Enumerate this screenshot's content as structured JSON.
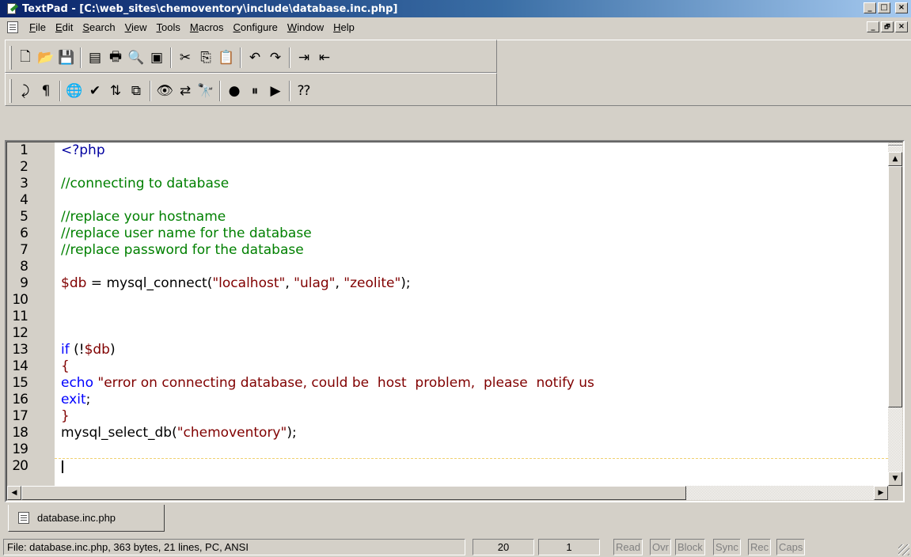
{
  "window": {
    "title": "TextPad - [C:\\web_sites\\chemoventory\\include\\database.inc.php]",
    "buttons": [
      "_",
      "□",
      "×"
    ]
  },
  "menu": {
    "items": [
      "File",
      "Edit",
      "Search",
      "View",
      "Tools",
      "Macros",
      "Configure",
      "Window",
      "Help"
    ],
    "underline": [
      "F",
      "E",
      "S",
      "V",
      "T",
      "M",
      "C",
      "W",
      "H"
    ],
    "mdi_buttons": [
      "_",
      "🗗",
      "×"
    ]
  },
  "toolbar1": {
    "buttons": [
      {
        "name": "new-file-icon",
        "glyph": "🗋"
      },
      {
        "name": "open-folder-icon",
        "glyph": "📂"
      },
      {
        "name": "save-icon",
        "glyph": "💾"
      },
      {
        "sep": true
      },
      {
        "name": "manage-files-icon",
        "glyph": "▤"
      },
      {
        "name": "print-icon",
        "glyph": "🖶"
      },
      {
        "name": "print-preview-icon",
        "glyph": "🔍"
      },
      {
        "name": "document-properties-icon",
        "glyph": "▣"
      },
      {
        "sep": true
      },
      {
        "name": "cut-icon",
        "glyph": "✂"
      },
      {
        "name": "copy-icon",
        "glyph": "⎘"
      },
      {
        "name": "paste-icon",
        "glyph": "📋"
      },
      {
        "sep": true
      },
      {
        "name": "undo-icon",
        "glyph": "↶"
      },
      {
        "name": "redo-icon",
        "glyph": "↷"
      },
      {
        "sep": true
      },
      {
        "name": "indent-icon",
        "glyph": "⇥"
      },
      {
        "name": "outdent-icon",
        "glyph": "⇤"
      }
    ]
  },
  "toolbar2": {
    "buttons": [
      {
        "name": "word-wrap-icon",
        "glyph": "⤸"
      },
      {
        "name": "visible-spaces-icon",
        "glyph": "¶"
      },
      {
        "sep": true
      },
      {
        "name": "web-browser-icon",
        "glyph": "🌐"
      },
      {
        "name": "spelling-icon",
        "glyph": "✔"
      },
      {
        "name": "sort-icon",
        "glyph": "⇅"
      },
      {
        "name": "compare-files-icon",
        "glyph": "⧉"
      },
      {
        "sep": true
      },
      {
        "name": "find-icon",
        "glyph": "👁"
      },
      {
        "name": "replace-icon",
        "glyph": "⇄"
      },
      {
        "name": "find-in-files-icon",
        "glyph": "🔭"
      },
      {
        "sep": true
      },
      {
        "name": "record-macro-icon",
        "glyph": "●"
      },
      {
        "name": "pause-macro-icon",
        "glyph": "⏸"
      },
      {
        "name": "play-macro-icon",
        "glyph": "▶"
      },
      {
        "sep": true
      },
      {
        "name": "context-help-icon",
        "glyph": "⁇"
      }
    ]
  },
  "editor": {
    "lines": [
      {
        "n": "1",
        "parts": [
          {
            "t": "<?php",
            "c": "c-tag"
          }
        ]
      },
      {
        "n": "2",
        "parts": []
      },
      {
        "n": "3",
        "parts": [
          {
            "t": "//connecting to database",
            "c": "c-cmt"
          }
        ]
      },
      {
        "n": "4",
        "parts": []
      },
      {
        "n": "5",
        "parts": [
          {
            "t": "//replace your hostname",
            "c": "c-cmt"
          }
        ]
      },
      {
        "n": "6",
        "parts": [
          {
            "t": "//replace user name for the database",
            "c": "c-cmt"
          }
        ]
      },
      {
        "n": "7",
        "parts": [
          {
            "t": "//replace password for the database",
            "c": "c-cmt"
          }
        ]
      },
      {
        "n": "8",
        "parts": []
      },
      {
        "n": "9",
        "parts": [
          {
            "t": "$db",
            "c": "c-var"
          },
          {
            "t": " = mysql_connect(",
            "c": "c-fn"
          },
          {
            "t": "\"localhost\"",
            "c": "c-str"
          },
          {
            "t": ", ",
            "c": "c-fn"
          },
          {
            "t": "\"ulag\"",
            "c": "c-str"
          },
          {
            "t": ", ",
            "c": "c-fn"
          },
          {
            "t": "\"zeolite\"",
            "c": "c-str"
          },
          {
            "t": ");",
            "c": "c-fn"
          }
        ]
      },
      {
        "n": "10",
        "parts": []
      },
      {
        "n": "11",
        "parts": []
      },
      {
        "n": "12",
        "parts": []
      },
      {
        "n": "13",
        "parts": [
          {
            "t": "if",
            "c": "c-kw"
          },
          {
            "t": " (!",
            "c": "c-fn"
          },
          {
            "t": "$db",
            "c": "c-var"
          },
          {
            "t": ")",
            "c": "c-fn"
          }
        ]
      },
      {
        "n": "14",
        "parts": [
          {
            "t": "{",
            "c": "c-var"
          }
        ]
      },
      {
        "n": "15",
        "parts": [
          {
            "t": "echo",
            "c": "c-kw"
          },
          {
            "t": " \"error on connecting database, could be  host  problem,  please  notify us",
            "c": "c-str"
          }
        ]
      },
      {
        "n": "16",
        "parts": [
          {
            "t": "exit",
            "c": "c-kw"
          },
          {
            "t": ";",
            "c": "c-fn"
          }
        ]
      },
      {
        "n": "17",
        "parts": [
          {
            "t": "}",
            "c": "c-var"
          }
        ]
      },
      {
        "n": "18",
        "parts": [
          {
            "t": "mysql_select_db(",
            "c": "c-fn"
          },
          {
            "t": "\"chemoventory\"",
            "c": "c-str"
          },
          {
            "t": ");",
            "c": "c-fn"
          }
        ]
      },
      {
        "n": "19",
        "parts": []
      },
      {
        "n": "20",
        "parts": []
      }
    ]
  },
  "tabs": [
    {
      "label": "database.inc.php"
    }
  ],
  "status": {
    "file_info": "File: database.inc.php, 363 bytes, 21 lines, PC, ANSI",
    "line": "20",
    "col": "1",
    "indicators": [
      "Read",
      "Ovr",
      "Block",
      "Sync",
      "Rec",
      "Caps"
    ]
  }
}
